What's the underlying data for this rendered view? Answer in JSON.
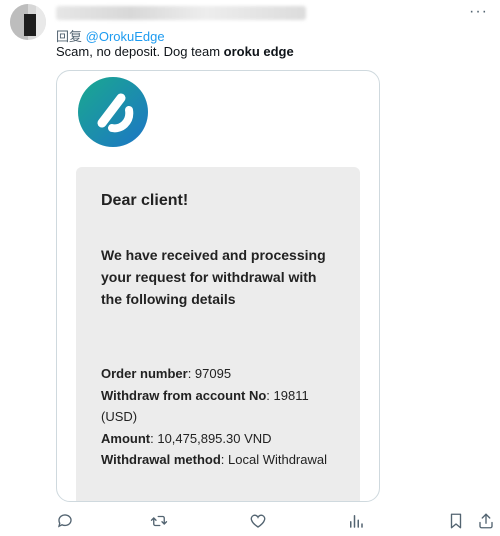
{
  "tweet": {
    "reply_prefix": "回复",
    "reply_to": "@OrokuEdge",
    "text_prefix": "Scam, no deposit. Dog team ",
    "text_bold": "oroku edge"
  },
  "email": {
    "greeting": "Dear client!",
    "intro": "We have received and processing your request for withdrawal with the following details",
    "order_label": "Order number",
    "order_value": "97095",
    "account_label": "Withdraw from account No",
    "account_value": "19811",
    "account_currency": "(USD)",
    "amount_label": "Amount",
    "amount_value": "10,475,895.30 VND",
    "method_label": "Withdrawal method",
    "method_value": "Local Withdrawal"
  },
  "colors": {
    "accent": "#1d9bf0",
    "logo_teal": "#1aa98f",
    "logo_blue": "#1d75c6",
    "card_bg": "#ececec"
  },
  "icons": [
    "more-icon",
    "reply-icon",
    "retweet-icon",
    "like-icon",
    "views-icon",
    "bookmark-icon",
    "share-icon"
  ]
}
